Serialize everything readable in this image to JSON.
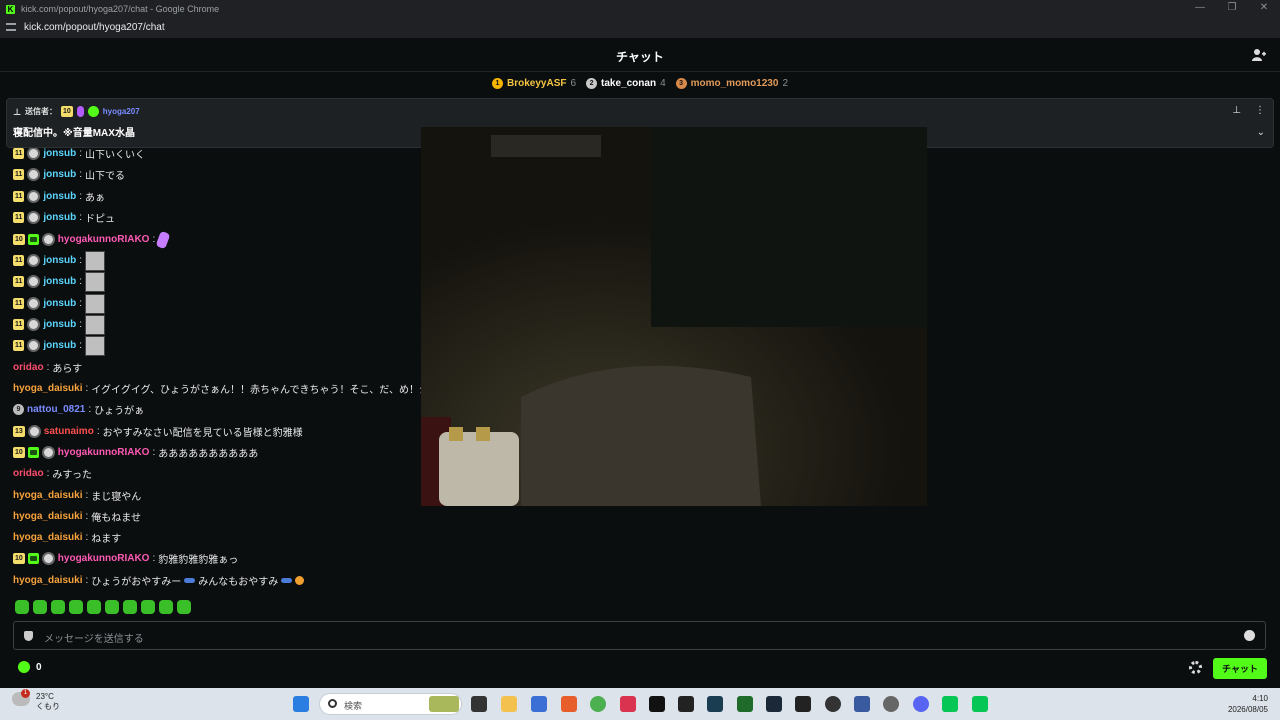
{
  "window": {
    "title": "kick.com/popout/hyoga207/chat - Google Chrome",
    "url": "kick.com/popout/hyoga207/chat"
  },
  "header": {
    "title": "チャット"
  },
  "leaderboard": [
    {
      "rank": "1",
      "name": "BrokeyyASF",
      "count": "6",
      "color": "#f4b400",
      "name_color": "#f4c542"
    },
    {
      "rank": "2",
      "name": "take_conan",
      "count": "4",
      "color": "#c8c8c8",
      "name_color": "#ffffff"
    },
    {
      "rank": "3",
      "name": "momo_momo1230",
      "count": "2",
      "color": "#d8894a",
      "name_color": "#e09a5a"
    }
  ],
  "pinned": {
    "label": "送信者：",
    "badge": "10",
    "user": "hyoga207",
    "message": "寝配信中。※音量MAX水晶"
  },
  "messages": [
    {
      "badge": "11",
      "user": "jonsub",
      "color": "#5bd6ff",
      "text": "山下いくいく"
    },
    {
      "badge": "11",
      "user": "jonsub",
      "color": "#5bd6ff",
      "text": "山下でる"
    },
    {
      "badge": "11",
      "user": "jonsub",
      "color": "#5bd6ff",
      "text": "あぁ"
    },
    {
      "badge": "11",
      "user": "jonsub",
      "color": "#5bd6ff",
      "text": "ドピュ"
    },
    {
      "badge": "10",
      "user": "hyogakunnoRIAKO",
      "color": "#ff5ab4",
      "text": ""
    },
    {
      "badge": "11",
      "user": "jonsub",
      "color": "#5bd6ff",
      "text": ""
    },
    {
      "badge": "11",
      "user": "jonsub",
      "color": "#5bd6ff",
      "text": ""
    },
    {
      "badge": "11",
      "user": "jonsub",
      "color": "#5bd6ff",
      "text": ""
    },
    {
      "badge": "11",
      "user": "jonsub",
      "color": "#5bd6ff",
      "text": ""
    },
    {
      "badge": "11",
      "user": "jonsub",
      "color": "#5bd6ff",
      "text": ""
    },
    {
      "badge": "",
      "user": "oridao",
      "color": "#ff4d6d",
      "text": "あらす"
    },
    {
      "badge": "",
      "user": "hyoga_daisuki",
      "color": "#f7a23b",
      "text": "イグイグイグ、ひょうがさぁん！！赤ちゃんできちゃう！そこ、だ、め！ジアァ"
    },
    {
      "badge": "9",
      "user": "nattou_0821",
      "color": "#7a8cff",
      "text": "ひょうがぁ"
    },
    {
      "badge": "13",
      "user": "satunaimo",
      "color": "#ff5050",
      "text": "おやすみなさい配信を見ている皆様と豹雅様"
    },
    {
      "badge": "10",
      "user": "hyogakunnoRIAKO",
      "color": "#ff5ab4",
      "text": "ああああああああああ"
    },
    {
      "badge": "",
      "user": "oridao",
      "color": "#ff4d6d",
      "text": "みすった"
    },
    {
      "badge": "",
      "user": "hyoga_daisuki",
      "color": "#f7a23b",
      "text": "まじ寝やん"
    },
    {
      "badge": "",
      "user": "hyoga_daisuki",
      "color": "#f7a23b",
      "text": "俺もねませ"
    },
    {
      "badge": "",
      "user": "hyoga_daisuki",
      "color": "#f7a23b",
      "text": "ねます"
    },
    {
      "badge": "10",
      "user": "hyogakunnoRIAKO",
      "color": "#ff5ab4",
      "text": "豹雅豹雅豹雅ぁっ"
    },
    {
      "badge": "",
      "user": "hyoga_daisuki",
      "color": "#f7a23b",
      "text": "ひょうがおやすみー"
    },
    {
      "extra": "みんなもおやすみ"
    }
  ],
  "input": {
    "placeholder": "メッセージを送信する"
  },
  "points": "0",
  "chat_button": "チャット",
  "taskbar": {
    "temp": "23°C",
    "weather": "くもり",
    "weather_badge": "1",
    "search_label": "検索",
    "time": "4:10",
    "date": "2026/08/05"
  }
}
